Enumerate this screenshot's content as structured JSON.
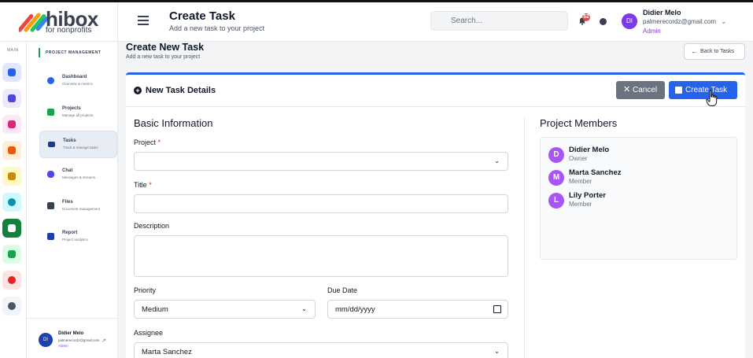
{
  "brand": {
    "name": "hibox",
    "tagline": "for nonprofits"
  },
  "header": {
    "title": "Create Task",
    "subtitle": "Add a new task to your project",
    "search_placeholder": "Search...",
    "notification_count": "52",
    "user": {
      "name": "Didier Melo",
      "email": "palmerecordz@gmail.com",
      "role": "Admin",
      "initials": "DI"
    }
  },
  "rail": {
    "label": "MAIN",
    "items": [
      {
        "icon": "home-icon",
        "color": "#2563eb",
        "bg": "#e0e7ff"
      },
      {
        "icon": "sitemap-icon",
        "color": "#4f46e5",
        "bg": "#ede9fe"
      },
      {
        "icon": "rocket-icon",
        "color": "#db2777",
        "bg": "#fce7f3"
      },
      {
        "icon": "building-icon",
        "color": "#ea580c",
        "bg": "#ffedd5"
      },
      {
        "icon": "graduation-icon",
        "color": "#ca8a04",
        "bg": "#fef9c3"
      },
      {
        "icon": "circle-icon",
        "color": "#0891b2",
        "bg": "#cffafe"
      },
      {
        "icon": "project-icon",
        "color": "#ffffff",
        "bg": "#15803d"
      },
      {
        "icon": "users-icon",
        "color": "#16a34a",
        "bg": "#dcfce7"
      },
      {
        "icon": "chart-pie-icon",
        "color": "#dc2626",
        "bg": "#fee2e2"
      },
      {
        "icon": "gear-icon",
        "color": "#475569",
        "bg": "#f1f5f9"
      }
    ]
  },
  "sidebar": {
    "section": "PROJECT MANAGEMENT",
    "items": [
      {
        "title": "Dashboard",
        "sub": "Overview & metrics",
        "color": "#2563eb"
      },
      {
        "title": "Projects",
        "sub": "Manage all projects",
        "color": "#16a34a"
      },
      {
        "title": "Tasks",
        "sub": "Track & manage tasks",
        "color": "#1e3a8a"
      },
      {
        "title": "Chat",
        "sub": "Messages & streams",
        "color": "#4f46e5"
      },
      {
        "title": "Files",
        "sub": "Document management",
        "color": "#374151"
      },
      {
        "title": "Report",
        "sub": "Project analytics",
        "color": "#1e40af"
      }
    ],
    "footer": {
      "name": "Didier Melo",
      "email": "palmerecordz@gmail.com",
      "role": "Admin",
      "initials": "DI"
    }
  },
  "main": {
    "title": "Create New Task",
    "subtitle": "Add a new task to your project",
    "back_label": "Back to Tasks",
    "card_title": "New Task Details",
    "cancel_label": "Cancel",
    "create_label": "Create Task",
    "basic_info": "Basic Information",
    "project_label": "Project",
    "project_value": "",
    "title_label": "Title",
    "title_value": "",
    "description_label": "Description",
    "priority_label": "Priority",
    "priority_value": "Medium",
    "due_label": "Due Date",
    "due_value": "mm/dd/yyyy",
    "assignee_label": "Assignee",
    "assignee_value": "Marta Sanchez",
    "required_mark": "*",
    "members_title": "Project Members",
    "members": [
      {
        "initial": "D",
        "name": "Didier Melo",
        "role": "Owner"
      },
      {
        "initial": "M",
        "name": "Marta Sanchez",
        "role": "Member"
      },
      {
        "initial": "L",
        "name": "Lily Porter",
        "role": "Member"
      }
    ]
  },
  "colors": {
    "accent": "#2563eb",
    "cancel": "#6b7280",
    "member_avatar": "#a855f7"
  }
}
